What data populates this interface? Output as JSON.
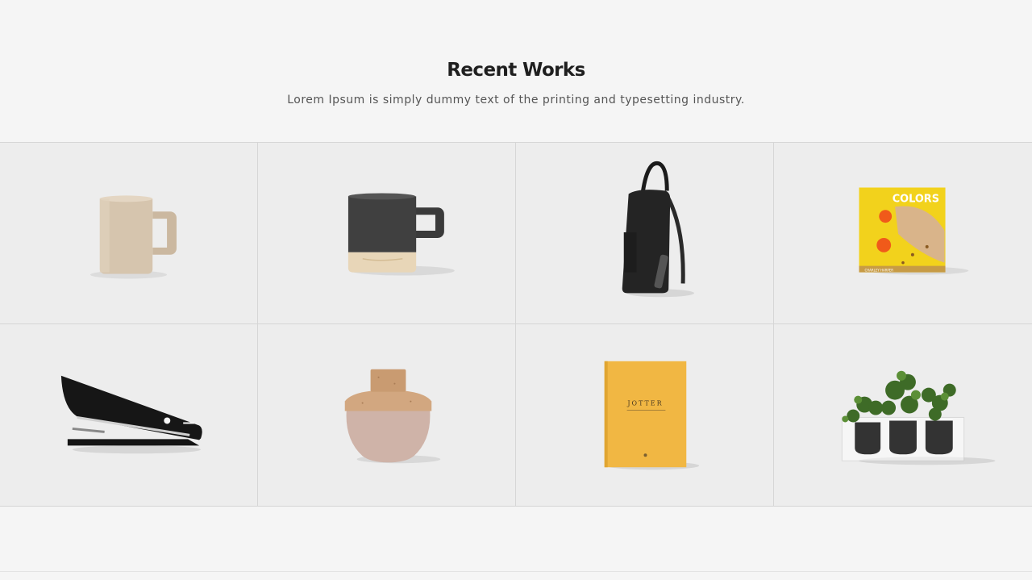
{
  "section": {
    "title": "Recent Works",
    "subtitle": "Lorem Ipsum is simply dummy text of the printing and typesetting industry."
  },
  "works": [
    {
      "item": "beige-mug"
    },
    {
      "item": "black-mug-wood-base"
    },
    {
      "item": "black-backpack"
    },
    {
      "item": "colors-book",
      "text": "COLORS",
      "author": "CHARLEY HARPER"
    },
    {
      "item": "black-stapler"
    },
    {
      "item": "cork-lid-jar"
    },
    {
      "item": "jotter-notebook",
      "text": "JOTTER"
    },
    {
      "item": "herb-planter"
    }
  ]
}
